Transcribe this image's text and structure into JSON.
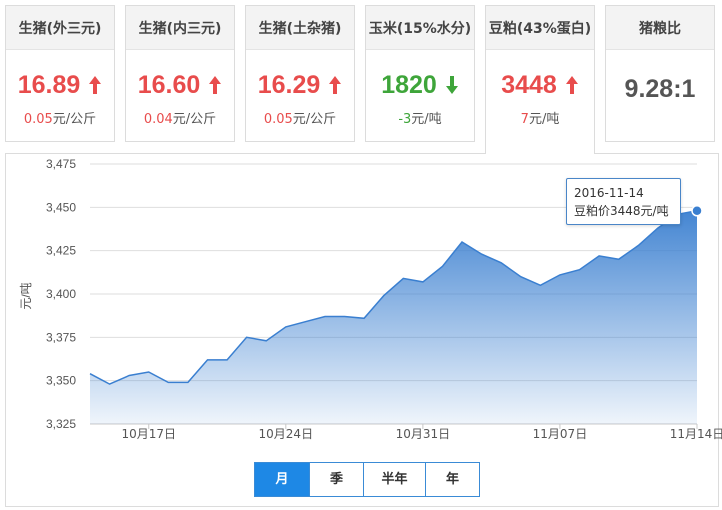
{
  "cards": [
    {
      "title": "生猪(外三元)",
      "price": "16.89",
      "direction": "up",
      "change": "0.05",
      "unit": "元/公斤"
    },
    {
      "title": "生猪(内三元)",
      "price": "16.60",
      "direction": "up",
      "change": "0.04",
      "unit": "元/公斤"
    },
    {
      "title": "生猪(土杂猪)",
      "price": "16.29",
      "direction": "up",
      "change": "0.05",
      "unit": "元/公斤"
    },
    {
      "title": "玉米(15%水分)",
      "price": "1820",
      "direction": "down",
      "change": "-3",
      "unit": "元/吨"
    },
    {
      "title": "豆粕(43%蛋白)",
      "price": "3448",
      "direction": "up",
      "change": "7",
      "unit": "元/吨"
    },
    {
      "title": "猪粮比",
      "price": "9.28:1",
      "direction": "none"
    }
  ],
  "tooltip": {
    "date": "2016-11-14",
    "text": "豆粕价3448元/吨"
  },
  "range_buttons": [
    {
      "label": "月",
      "selected": true
    },
    {
      "label": "季",
      "selected": false
    },
    {
      "label": "半年",
      "selected": false
    },
    {
      "label": "年",
      "selected": false
    }
  ],
  "colors": {
    "up": "#e84c4c",
    "down": "#3ea53a",
    "series": "#3a7fd0",
    "accent": "#1e88e5"
  },
  "chart_data": {
    "type": "area",
    "ylabel": "元/吨",
    "ylim": [
      3325,
      3475
    ],
    "yticks": [
      3325,
      3350,
      3375,
      3400,
      3425,
      3450,
      3475
    ],
    "ytick_labels": [
      "3,325",
      "3,350",
      "3,375",
      "3,400",
      "3,425",
      "3,450",
      "3,475"
    ],
    "xlim": [
      "2016-10-14",
      "2016-11-14"
    ],
    "xtick_dates": [
      "2016-10-17",
      "2016-10-24",
      "2016-10-31",
      "2016-11-07",
      "2016-11-14"
    ],
    "xtick_labels": [
      "10月17日",
      "10月24日",
      "10月31日",
      "11月07日",
      "11月14日"
    ],
    "grid": true,
    "series": [
      {
        "x": [
          "2016-10-14",
          "2016-10-15",
          "2016-10-16",
          "2016-10-17",
          "2016-10-18",
          "2016-10-19",
          "2016-10-20",
          "2016-10-21",
          "2016-10-22",
          "2016-10-23",
          "2016-10-24",
          "2016-10-25",
          "2016-10-26",
          "2016-10-27",
          "2016-10-28",
          "2016-10-29",
          "2016-10-30",
          "2016-10-31",
          "2016-11-01",
          "2016-11-02",
          "2016-11-03",
          "2016-11-04",
          "2016-11-05",
          "2016-11-06",
          "2016-11-07",
          "2016-11-08",
          "2016-11-09",
          "2016-11-10",
          "2016-11-11",
          "2016-11-12",
          "2016-11-13",
          "2016-11-14"
        ],
        "values": [
          3354,
          3348,
          3353,
          3355,
          3349,
          3349,
          3362,
          3362,
          3375,
          3373,
          3381,
          3384,
          3387,
          3387,
          3386,
          3399,
          3409,
          3407,
          3416,
          3430,
          3423,
          3418,
          3410,
          3405,
          3411,
          3414,
          3422,
          3420,
          3428,
          3438,
          3446,
          3448
        ]
      }
    ]
  }
}
